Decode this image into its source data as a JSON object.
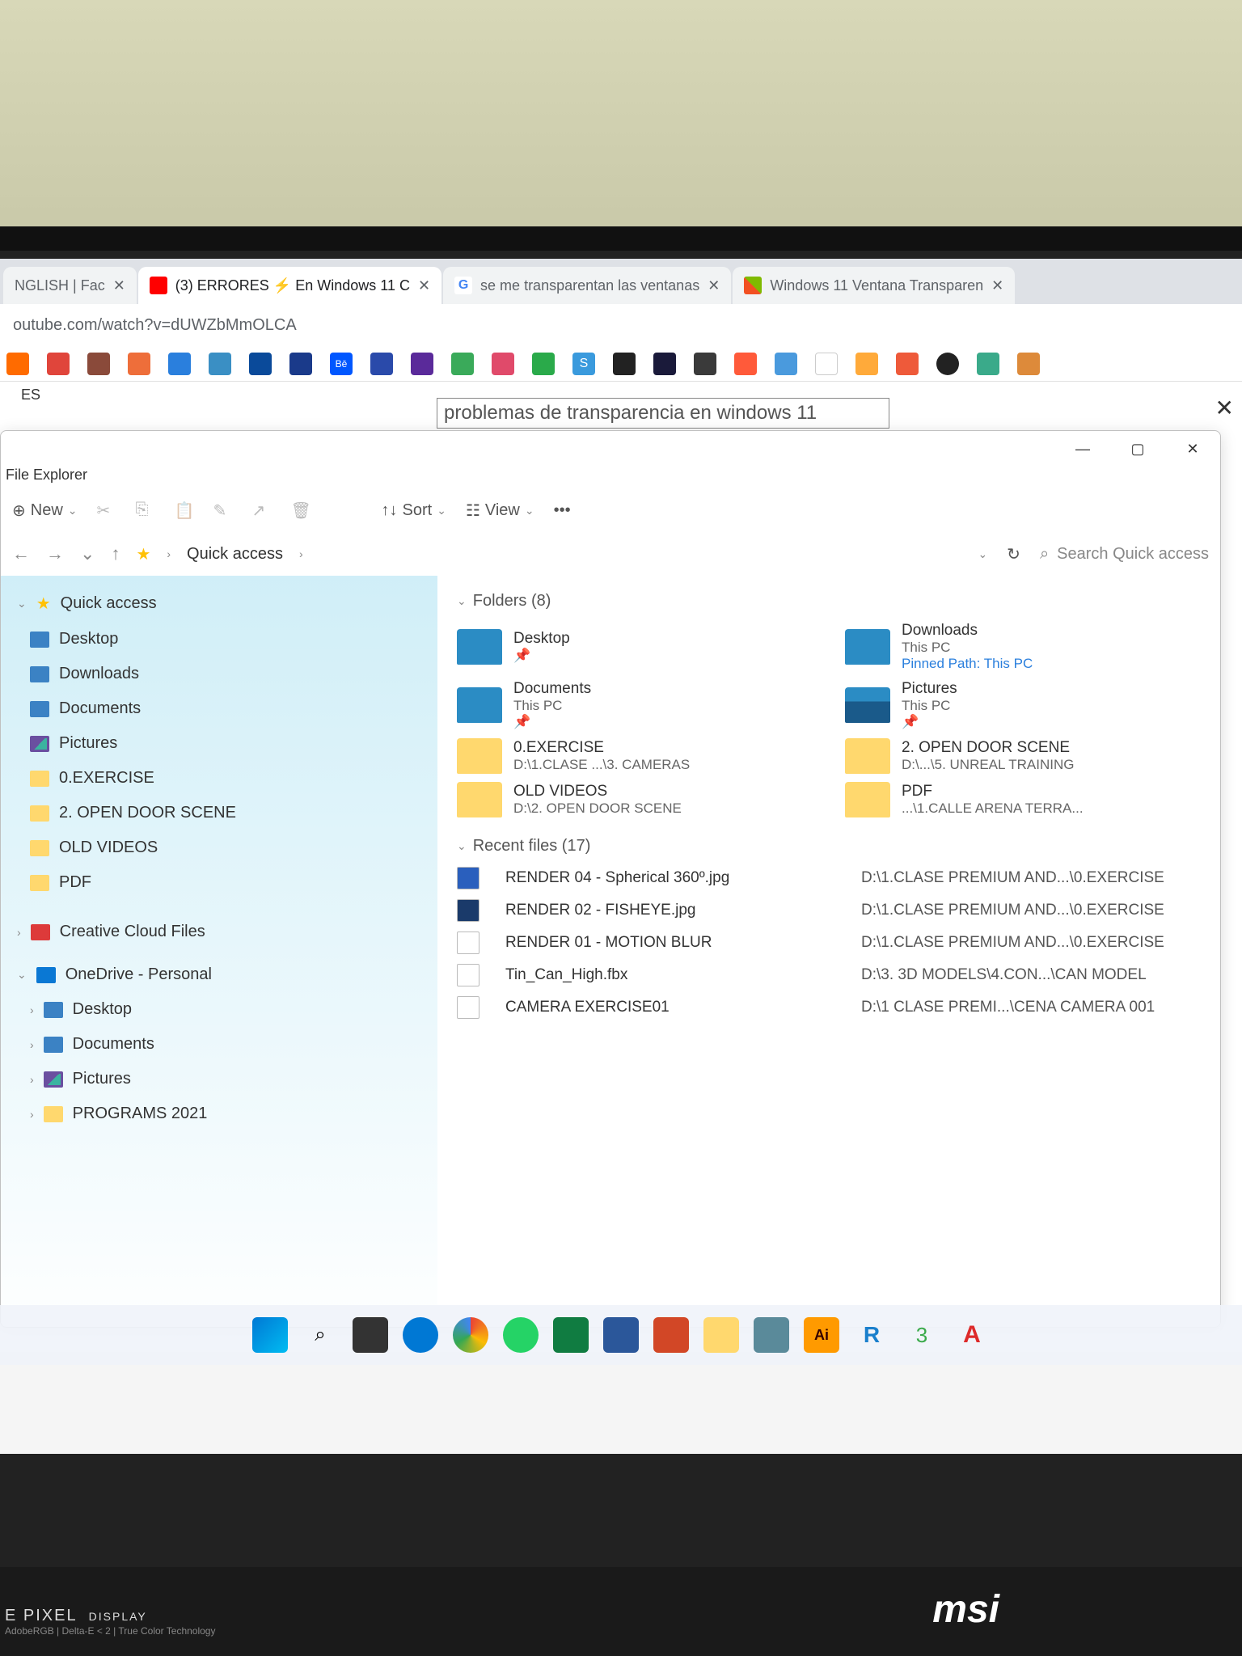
{
  "browser": {
    "tabs": [
      {
        "label": "NGLISH | Fac",
        "icon": ""
      },
      {
        "label": "(3) ERRORES ⚡ En Windows 11 C",
        "icon": "yt"
      },
      {
        "label": "se me transparentan las ventanas",
        "icon": "g"
      },
      {
        "label": "Windows 11 Ventana Transparen",
        "icon": "ms"
      }
    ],
    "url": "outube.com/watch?v=dUWZbMmOLCA"
  },
  "page": {
    "lang": "ES",
    "search_text": "problemas de transparencia en windows 11"
  },
  "explorer": {
    "title": "File Explorer",
    "toolbar": {
      "new": "New",
      "sort": "Sort",
      "view": "View"
    },
    "breadcrumb": "Quick access",
    "search_placeholder": "Search Quick access",
    "sidebar": {
      "quick_access": "Quick access",
      "items": [
        {
          "label": "Desktop",
          "icon": "desktop-ic"
        },
        {
          "label": "Downloads",
          "icon": "downloads-ic"
        },
        {
          "label": "Documents",
          "icon": "documents-ic"
        },
        {
          "label": "Pictures",
          "icon": "pictures-ic"
        },
        {
          "label": "0.EXERCISE",
          "icon": "folder-ic"
        },
        {
          "label": "2. OPEN DOOR SCENE",
          "icon": "folder-ic"
        },
        {
          "label": "OLD VIDEOS",
          "icon": "folder-ic"
        },
        {
          "label": "PDF",
          "icon": "folder-ic"
        }
      ],
      "cloud": "Creative Cloud Files",
      "onedrive": "OneDrive - Personal",
      "od_items": [
        {
          "label": "Desktop"
        },
        {
          "label": "Documents"
        },
        {
          "label": "Pictures"
        },
        {
          "label": "PROGRAMS 2021"
        }
      ]
    },
    "folders_header": "Folders (8)",
    "folders": [
      {
        "name": "Desktop",
        "sub": "",
        "pin": true,
        "thumb": "system"
      },
      {
        "name": "Downloads",
        "sub": "This PC",
        "extra": "Pinned\nPath: This PC",
        "thumb": "system"
      },
      {
        "name": "Documents",
        "sub": "This PC",
        "pin": true,
        "thumb": "system"
      },
      {
        "name": "Pictures",
        "sub": "This PC",
        "pin": true,
        "thumb": "pics"
      },
      {
        "name": "0.EXERCISE",
        "sub": "D:\\1.CLASE ...\\3. CAMERAS",
        "thumb": ""
      },
      {
        "name": "2. OPEN DOOR SCENE",
        "sub": "D:\\...\\5. UNREAL TRAINING",
        "thumb": ""
      },
      {
        "name": "OLD VIDEOS",
        "sub": "D:\\2. OPEN DOOR SCENE",
        "thumb": ""
      },
      {
        "name": "PDF",
        "sub": "...\\1.CALLE ARENA TERRA...",
        "thumb": ""
      }
    ],
    "recent_header": "Recent files (17)",
    "files": [
      {
        "name": "RENDER 04 - Spherical 360º.jpg",
        "path": "D:\\1.CLASE PREMIUM AND...\\0.EXERCISE"
      },
      {
        "name": "RENDER 02 - FISHEYE.jpg",
        "path": "D:\\1.CLASE PREMIUM AND...\\0.EXERCISE"
      },
      {
        "name": "RENDER 01 - MOTION BLUR",
        "path": "D:\\1.CLASE PREMIUM AND...\\0.EXERCISE"
      },
      {
        "name": "Tin_Can_High.fbx",
        "path": "D:\\3. 3D MODELS\\4.CON...\\CAN MODEL"
      },
      {
        "name": "CAMERA EXERCISE01",
        "path": "D:\\1 CLASE PREMI...\\CENA CAMERA 001"
      }
    ]
  },
  "laptop": {
    "pixel": "E PIXEL",
    "display": "DISPLAY",
    "sub": "AdobeRGB | Delta-E < 2 | True Color Technology",
    "brand": "msi"
  }
}
